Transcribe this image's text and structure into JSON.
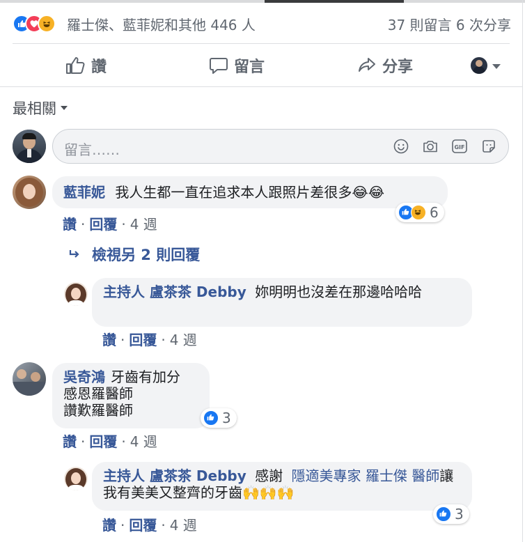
{
  "reactions": {
    "icons": [
      "like-icon",
      "love-icon",
      "haha-icon"
    ],
    "names": "羅士傑、藍菲妮和其他 446 人",
    "counts": "37 則留言  6 次分享"
  },
  "actions": {
    "like": "讚",
    "comment": "留言",
    "share": "分享"
  },
  "sort": {
    "label": "最相關"
  },
  "composer": {
    "placeholder": "留言……"
  },
  "comments": [
    {
      "author": "藍菲妮",
      "text": "我人生都一直在追求本人跟照片差很多😂😂",
      "reaction_count": "6",
      "meta": {
        "like": "讚",
        "reply": "回覆",
        "time": "4 週"
      },
      "view_more": "檢視另 2 則回覆",
      "replies": [
        {
          "author": "主持人 盧茶茶 Debby",
          "text": "妳明明也沒差在那邊哈哈哈",
          "meta": {
            "like": "讚",
            "reply": "回覆",
            "time": "4 週"
          }
        }
      ]
    },
    {
      "author": "吳奇鴻",
      "line1": "牙齒有加分",
      "line2": "感恩羅醫師",
      "line3": "讚歎羅醫師",
      "reaction_count": "3",
      "meta": {
        "like": "讚",
        "reply": "回覆",
        "time": "4 週"
      },
      "replies": [
        {
          "author": "主持人 盧茶茶 Debby",
          "pre": "感謝",
          "mention": "隱適美專家 羅士傑 醫師",
          "text": "讓我有美美又整齊的牙齒🙌🙌🙌",
          "reaction_count": "3",
          "meta": {
            "like": "讚",
            "reply": "回覆",
            "time": "4 週"
          }
        }
      ]
    }
  ],
  "colors": {
    "accent": "#385898",
    "like": "#1877f2",
    "love": "#f33e58",
    "haha": "#f7b125"
  }
}
